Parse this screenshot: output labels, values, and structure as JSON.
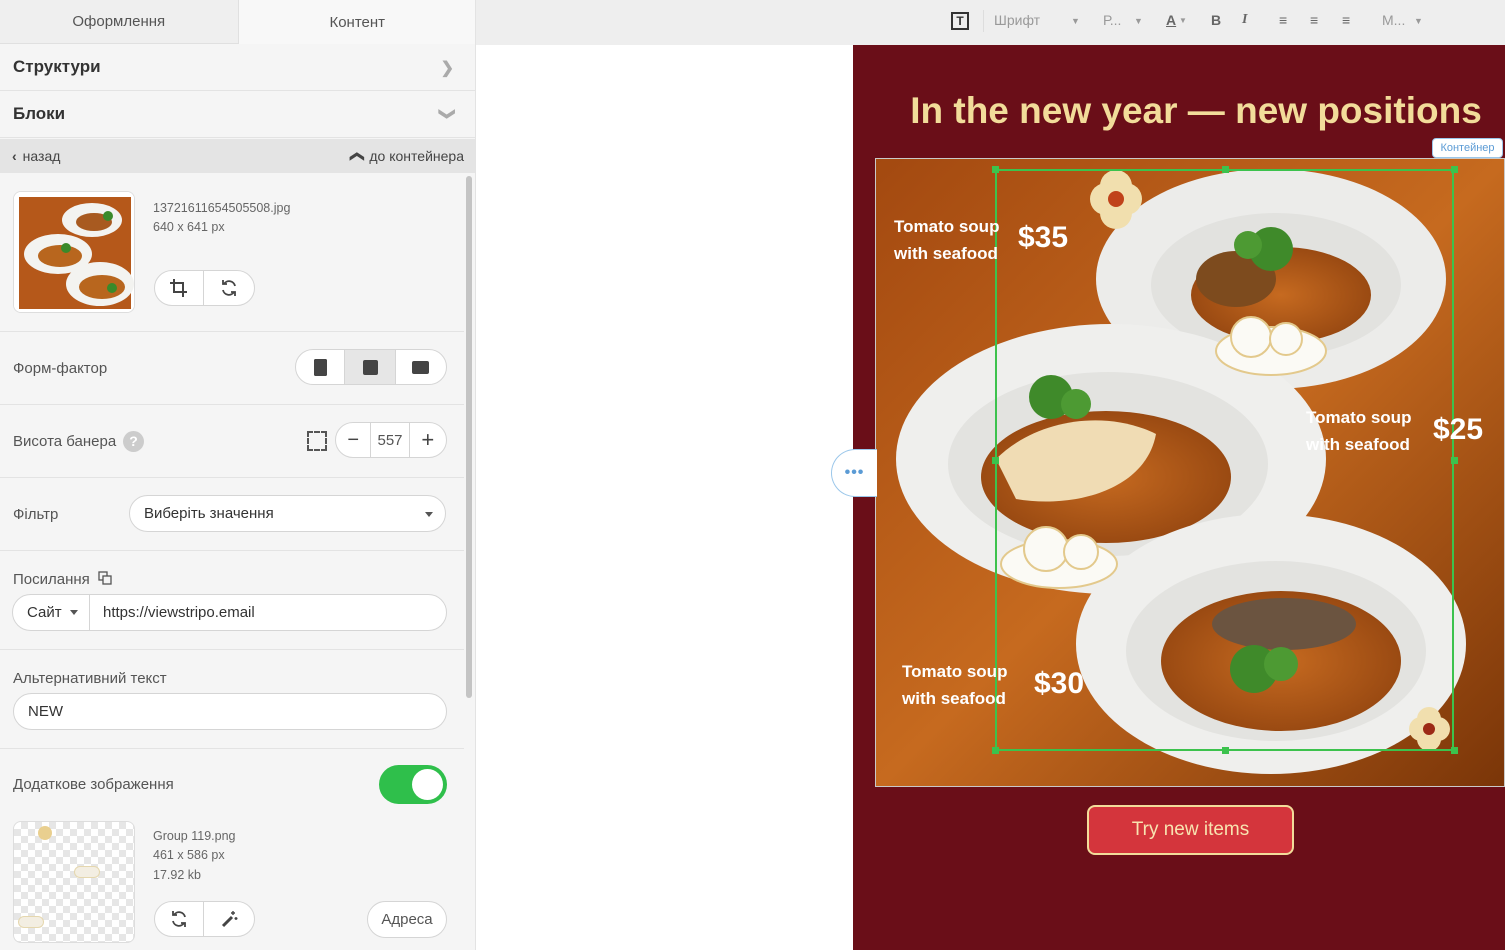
{
  "tabs": [
    {
      "label": "Оформлення"
    },
    {
      "label": "Контент"
    }
  ],
  "sections": {
    "structures": "Структури",
    "blocks": "Блоки"
  },
  "nav": {
    "back": "назад",
    "to_container": "до контейнера"
  },
  "image": {
    "filename": "13721611654505508.jpg",
    "dimensions": "640 x 641 px"
  },
  "form_factor": {
    "label": "Форм-фактор"
  },
  "banner_height": {
    "label": "Висота банера",
    "value": "557"
  },
  "filter": {
    "label": "Фільтр",
    "placeholder": "Виберіть значення"
  },
  "link": {
    "label": "Посилання",
    "type": "Сайт",
    "url": "https://viewstripo.email"
  },
  "alt_text": {
    "label": "Альтернативний текст",
    "value": "NEW"
  },
  "extra_image": {
    "label": "Додаткове зображення",
    "enabled": true,
    "filename": "Group 119.png",
    "dimensions": "461 x 586 px",
    "size": "17.92 kb",
    "address_button": "Адреса"
  },
  "toolbar": {
    "font": "Шрифт",
    "size": "Р...",
    "more": "М..."
  },
  "email": {
    "headline": "In the new year — new positions",
    "container_label": "Контейнер",
    "items": [
      {
        "name_line1": "Tomato soup",
        "name_line2": "with seafood",
        "price": "$35"
      },
      {
        "name_line1": "Tomato soup",
        "name_line2": "with seafood",
        "price": "$25"
      },
      {
        "name_line1": "Tomato soup",
        "name_line2": "with seafood",
        "price": "$30"
      }
    ],
    "cta": "Try new items"
  },
  "colors": {
    "email_bg": "#6a0e18",
    "headline": "#f2dc9a",
    "cta_bg": "#d4353c",
    "toggle_on": "#2fbf4b",
    "selection": "#3cc24d"
  }
}
